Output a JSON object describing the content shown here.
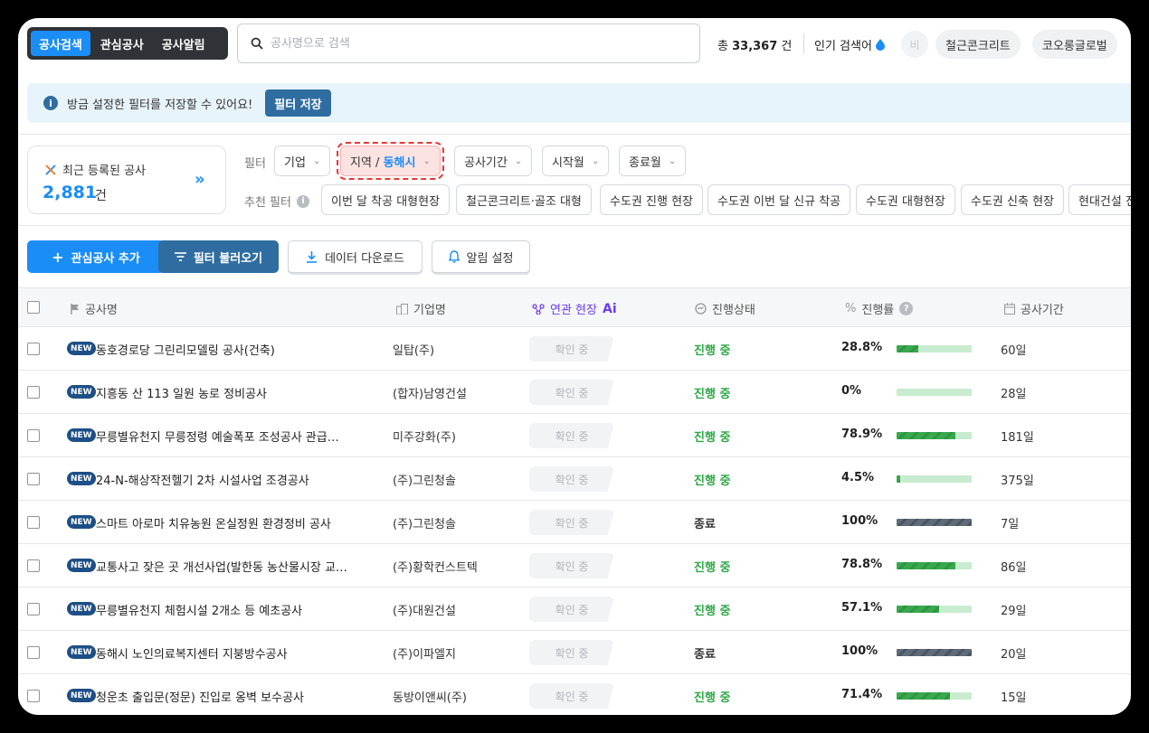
{
  "nav": {
    "tabs": [
      {
        "label": "공사검색",
        "active": true
      },
      {
        "label": "관심공사",
        "active": false
      },
      {
        "label": "공사알림",
        "active": false
      }
    ]
  },
  "search": {
    "placeholder": "공사명으로 검색",
    "value": ""
  },
  "summary": {
    "prefix": "총",
    "count": "33,367",
    "suffix": "건"
  },
  "popular": {
    "label": "인기 검색어",
    "faded_keyword": "비",
    "keywords": [
      "철근콘크리트",
      "코오롱글로벌"
    ]
  },
  "banner": {
    "message": "방금 설정한 필터를 저장할 수 있어요!",
    "save_label": "필터 저장"
  },
  "recent": {
    "title": "최근 등록된 공사",
    "count": "2,881",
    "unit": "건",
    "more": "»"
  },
  "filters": {
    "label": "필터",
    "chips": {
      "company": "기업",
      "region_label": "지역 /",
      "region_value": "동해시",
      "period": "공사기간",
      "start_month": "시작월",
      "end_month": "종료월"
    },
    "recommend_label": "추천 필터",
    "recommended": [
      "이번 달 착공 대형현장",
      "철근콘크리트·골조 대형",
      "수도권 진행 현장",
      "수도권 이번 달 신규 착공",
      "수도권 대형현장",
      "수도권 신축 현장",
      "현대건설 진"
    ]
  },
  "actions": {
    "add_watch": "관심공사 추가",
    "load_filter": "필터 불러오기",
    "download": "데이터 다운로드",
    "alert": "알림 설정"
  },
  "table": {
    "headers": {
      "name": "공사명",
      "company": "기업명",
      "related": "연관 현장",
      "ai": "Ai",
      "status": "진행상태",
      "progress": "진행률",
      "period": "공사기간"
    },
    "new_label": "NEW",
    "confirm_label": "확인 중",
    "rows": [
      {
        "name": "동호경로당 그린리모델링 공사(건축)",
        "company": "일탑(주)",
        "status": "진행 중",
        "active": true,
        "rate": "28.8%",
        "progress": 28.8,
        "period": "60일"
      },
      {
        "name": "지흥동 산 113 일원 농로 정비공사",
        "company": "(합자)남영건설",
        "status": "진행 중",
        "active": true,
        "rate": "0%",
        "progress": 0,
        "period": "28일"
      },
      {
        "name": "무릉별유천지 무릉정령 예술폭포 조성공사 관급…",
        "company": "미주강화(주)",
        "status": "진행 중",
        "active": true,
        "rate": "78.9%",
        "progress": 78.9,
        "period": "181일"
      },
      {
        "name": "24-N-해상작전헬기 2차 시설사업 조경공사",
        "company": "(주)그린청솔",
        "status": "진행 중",
        "active": true,
        "rate": "4.5%",
        "progress": 4.5,
        "period": "375일"
      },
      {
        "name": "스마트 아로마 치유농원 온실정원 환경정비 공사",
        "company": "(주)그린청솔",
        "status": "종료",
        "active": false,
        "rate": "100%",
        "progress": 100,
        "period": "7일"
      },
      {
        "name": "교통사고 잦은 곳 개선사업(발한동 농산물시장 교…",
        "company": "(주)황학컨스트텍",
        "status": "진행 중",
        "active": true,
        "rate": "78.8%",
        "progress": 78.8,
        "period": "86일"
      },
      {
        "name": "무릉별유천지 체험시설 2개소 등 예초공사",
        "company": "(주)대원건설",
        "status": "진행 중",
        "active": true,
        "rate": "57.1%",
        "progress": 57.1,
        "period": "29일"
      },
      {
        "name": "동해시 노인의료복지센터 지붕방수공사",
        "company": "(주)이파엘지",
        "status": "종료",
        "active": false,
        "rate": "100%",
        "progress": 100,
        "period": "20일"
      },
      {
        "name": "청운초 출입문(정문) 진입로 옹벽 보수공사",
        "company": "동방이앤씨(주)",
        "status": "진행 중",
        "active": true,
        "rate": "71.4%",
        "progress": 71.4,
        "period": "15일"
      }
    ]
  }
}
